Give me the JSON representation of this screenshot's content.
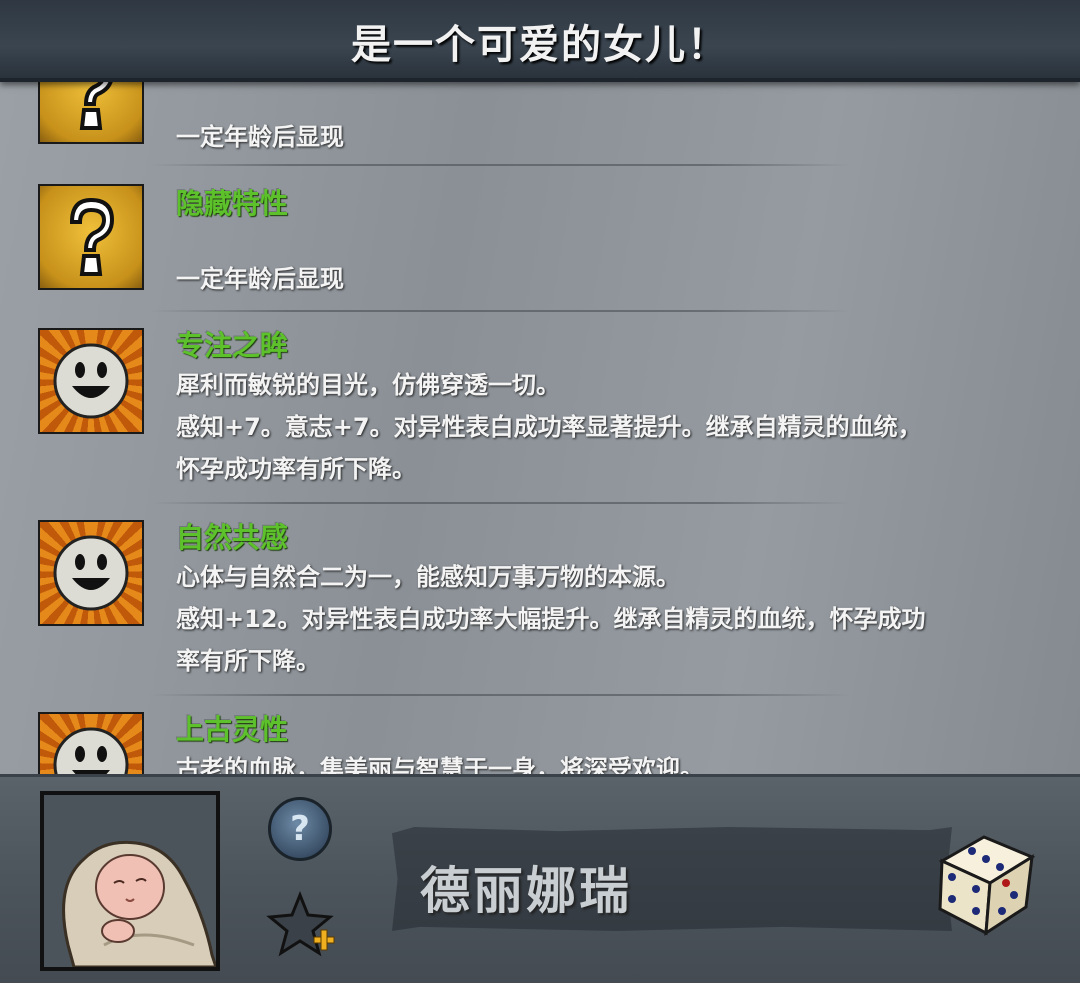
{
  "header": {
    "title": "是一个可爱的女儿！"
  },
  "traits": [
    {
      "icon": "question-mark-icon",
      "name": "",
      "lines": [
        "一定年龄后显现"
      ]
    },
    {
      "icon": "question-mark-icon",
      "name": "隐藏特性",
      "lines": [
        "一定年龄后显现"
      ]
    },
    {
      "icon": "smiling-face-icon",
      "name": "专注之眸",
      "lines": [
        "犀利而敏锐的目光，仿佛穿透一切。",
        "感知+7。意志+7。对异性表白成功率显著提升。继承自精灵的血统，",
        "怀孕成功率有所下降。"
      ]
    },
    {
      "icon": "smiling-face-icon",
      "name": "自然共感",
      "lines": [
        "心体与自然合二为一，能感知万事万物的本源。",
        "感知+12。对异性表白成功率大幅提升。继承自精灵的血统，怀孕成功",
        "率有所下降。"
      ]
    },
    {
      "icon": "smiling-face-icon",
      "name": "上古灵性",
      "lines": [
        "古老的血脉，集美丽与智慧于一身，将深受欢迎。"
      ]
    }
  ],
  "character": {
    "name": "德丽娜瑞",
    "portrait": "swaddled-baby-portrait"
  },
  "buttons": {
    "help_icon": "?",
    "favorite": "star-plus-icon",
    "randomize": "dice-icon"
  },
  "colors": {
    "trait_name": "#5cc12a",
    "desc_text": "#f4f4f4",
    "header_bg": "#2f3842"
  }
}
